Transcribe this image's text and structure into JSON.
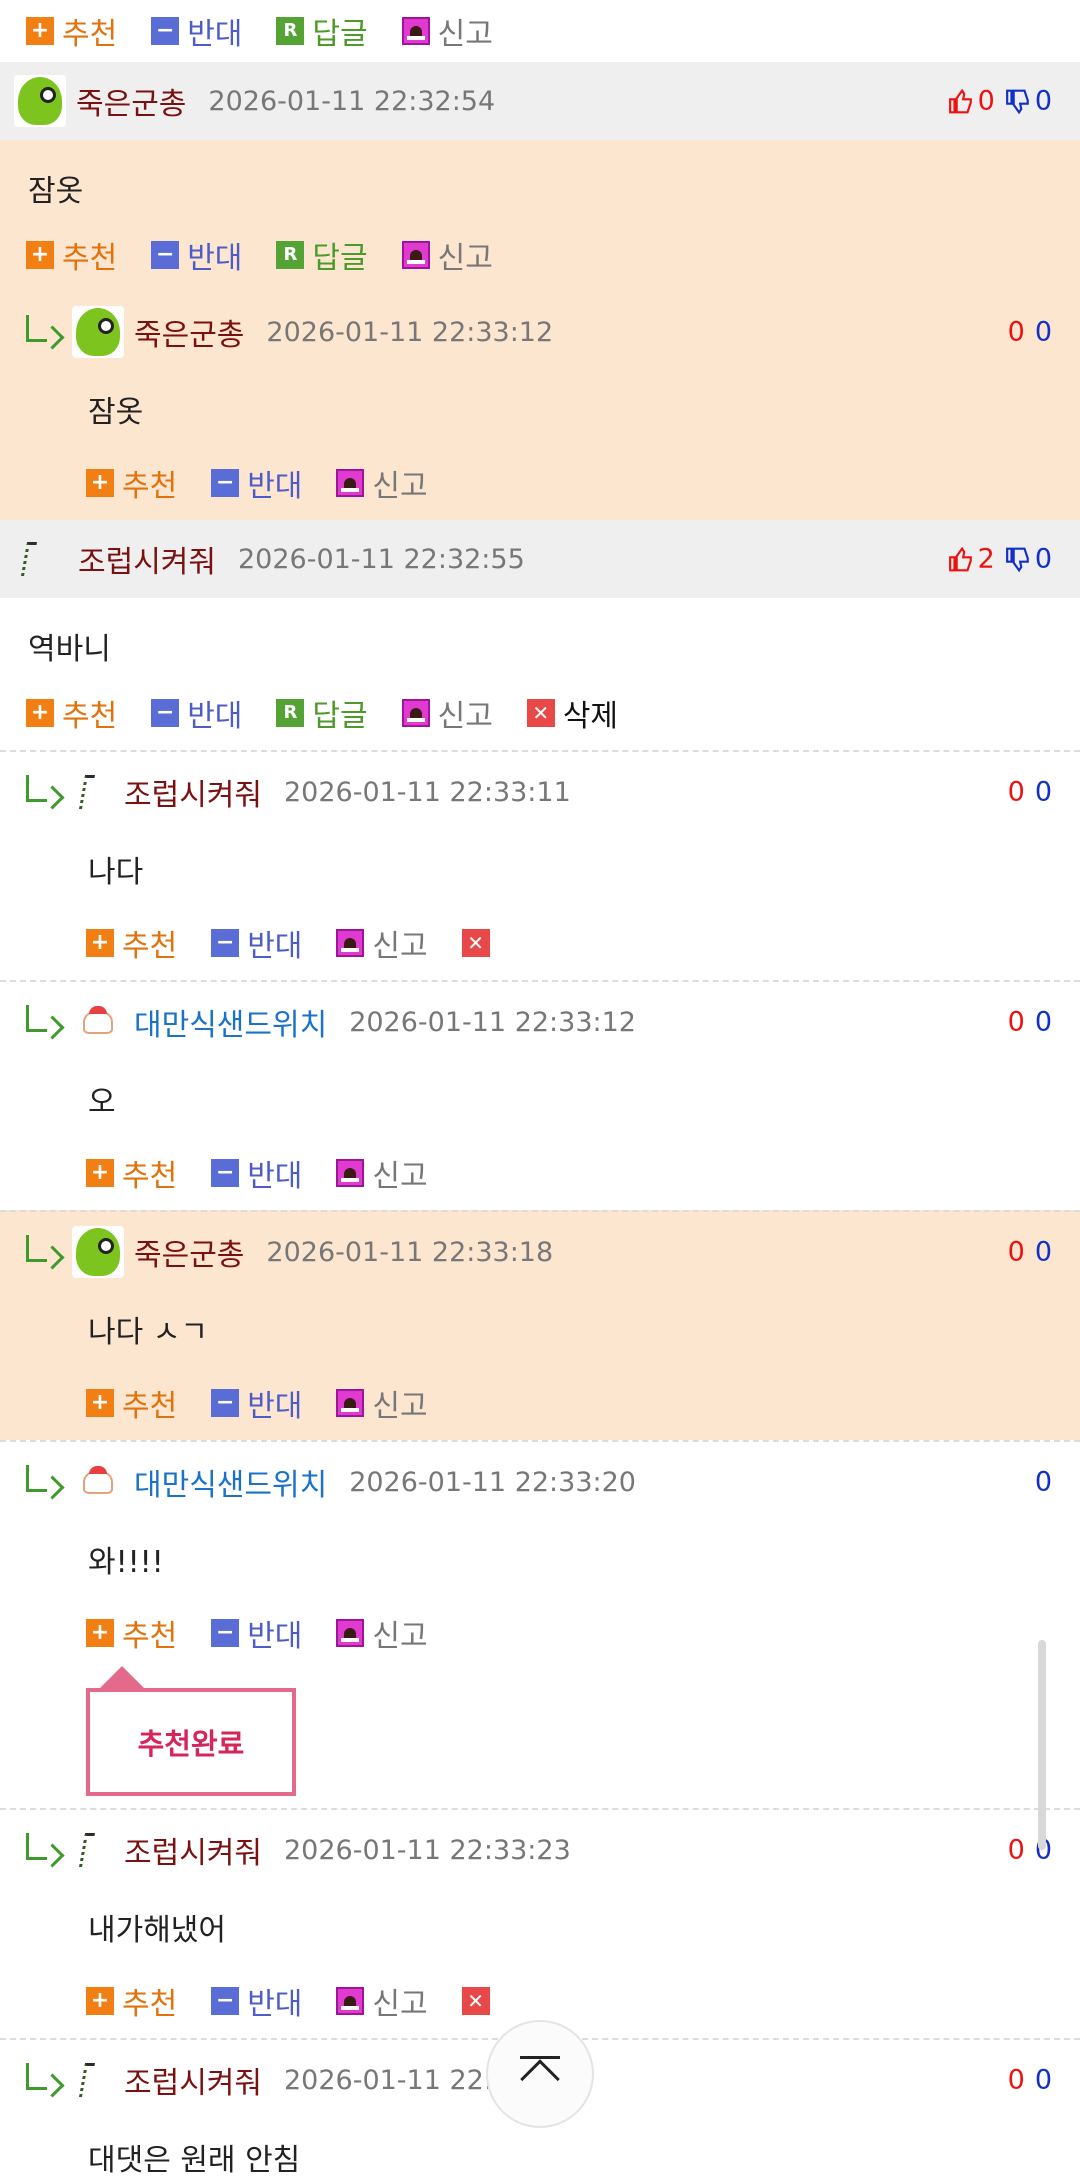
{
  "labels": {
    "recommend": "추천",
    "oppose": "반대",
    "reply": "답글",
    "report": "신고",
    "delete": "삭제",
    "reply_icon_letter": "R",
    "plus_glyph": "+",
    "minus_glyph": "−",
    "x_glyph": "✕"
  },
  "comments": [
    {
      "name": "죽은군총",
      "date": "2026-01-11 22:32:54",
      "up": "0",
      "down": "0",
      "text": "잠옷",
      "replies": [
        {
          "name": "죽은군총",
          "date": "2026-01-11 22:33:12",
          "up": "0",
          "down": "0",
          "text": "잠옷"
        }
      ]
    },
    {
      "name": "조럽시켜줘",
      "date": "2026-01-11 22:32:55",
      "up": "2",
      "down": "0",
      "text": "역바니",
      "replies": [
        {
          "name": "조럽시켜줘",
          "date": "2026-01-11 22:33:11",
          "up": "0",
          "down": "0",
          "text": "나다"
        },
        {
          "name": "대만식샌드위치",
          "date": "2026-01-11 22:33:12",
          "up": "0",
          "down": "0",
          "text": "오"
        },
        {
          "name": "죽은군총",
          "date": "2026-01-11 22:33:18",
          "up": "0",
          "down": "0",
          "text": "나다 ㅅㄱ"
        },
        {
          "name": "대만식샌드위치",
          "date": "2026-01-11 22:33:20",
          "up": "",
          "down": "0",
          "text": "와!!!!",
          "tooltip": "추천완료"
        },
        {
          "name": "조럽시켜줘",
          "date": "2026-01-11 22:33:23",
          "up": "0",
          "down": "0",
          "text": "내가해냈어"
        },
        {
          "name": "조럽시켜줘",
          "date": "2026-01-11 22:33:37",
          "up": "0",
          "down": "0",
          "text": "대댓은 원래 안침"
        }
      ]
    }
  ]
}
